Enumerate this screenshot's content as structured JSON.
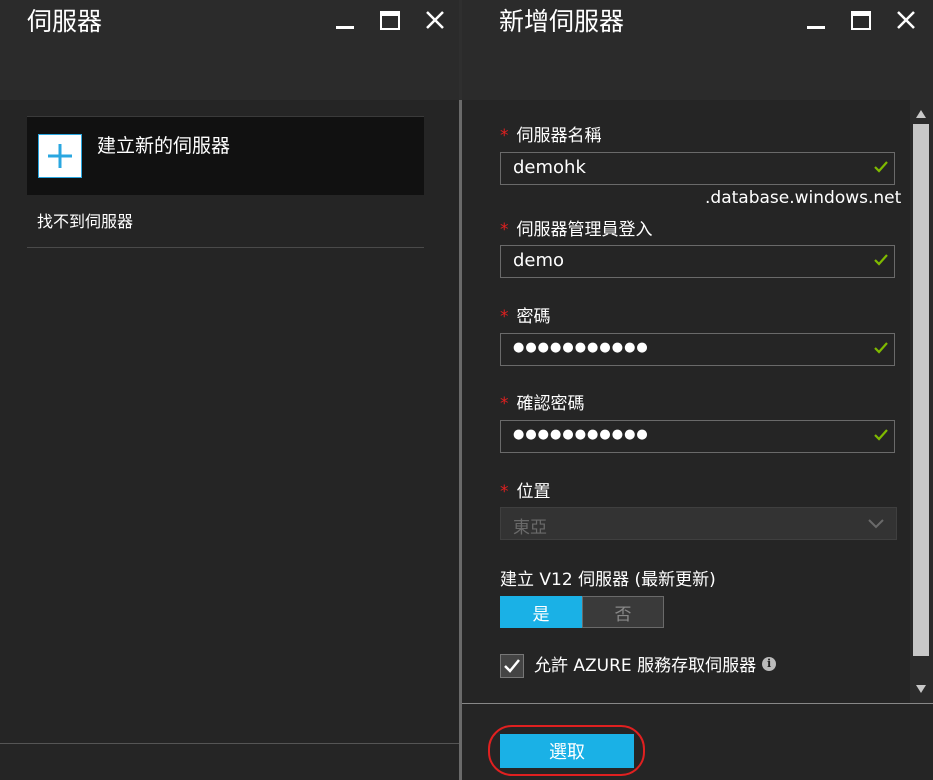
{
  "left_blade": {
    "title": "伺服器",
    "create_label": "建立新的伺服器",
    "not_found_label": "找不到伺服器"
  },
  "right_blade": {
    "title": "新增伺服器",
    "server_name": {
      "label": "伺服器名稱",
      "value": "demohk",
      "suffix": ".database.windows.net",
      "valid": true
    },
    "admin_login": {
      "label": "伺服器管理員登入",
      "value": "demo",
      "valid": true
    },
    "password": {
      "label": "密碼",
      "value": "●●●●●●●●●●●",
      "valid": true
    },
    "confirm_password": {
      "label": "確認密碼",
      "value": "●●●●●●●●●●●",
      "valid": true
    },
    "location": {
      "label": "位置",
      "value": "東亞"
    },
    "v12": {
      "label": "建立 V12 伺服器 (最新更新)",
      "yes_label": "是",
      "no_label": "否",
      "selected": "是"
    },
    "allow_azure": {
      "label": "允許 AZURE 服務存取伺服器",
      "checked": true
    },
    "select_button": "選取"
  },
  "colors": {
    "accent": "#1ab1e6",
    "required": "#e02020",
    "valid_check": "#7fba00",
    "background": "#252525"
  }
}
